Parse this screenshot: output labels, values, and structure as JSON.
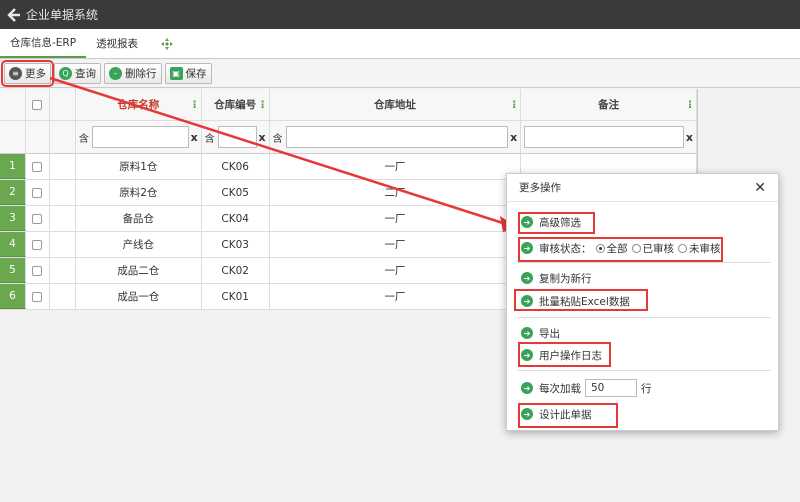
{
  "app": {
    "title": "企业单据系统"
  },
  "tabs": [
    {
      "label": "仓库信息-ERP",
      "active": true
    },
    {
      "label": "透视报表",
      "active": false
    }
  ],
  "toolbar": {
    "more": "更多",
    "query": "查询",
    "delete_row": "删除行",
    "save": "保存"
  },
  "grid": {
    "columns": {
      "name": "仓库名称",
      "code": "仓库编号",
      "address": "仓库地址",
      "note": "备注"
    },
    "filter": {
      "contains": "含",
      "clear": "x"
    },
    "rows": [
      {
        "num": "1",
        "name": "原料1仓",
        "code": "CK06",
        "address": "一厂"
      },
      {
        "num": "2",
        "name": "原料2仓",
        "code": "CK05",
        "address": "二厂"
      },
      {
        "num": "3",
        "name": "备品仓",
        "code": "CK04",
        "address": "一厂"
      },
      {
        "num": "4",
        "name": "产线仓",
        "code": "CK03",
        "address": "一厂"
      },
      {
        "num": "5",
        "name": "成品二仓",
        "code": "CK02",
        "address": "一厂"
      },
      {
        "num": "6",
        "name": "成品一仓",
        "code": "CK01",
        "address": "一厂"
      }
    ]
  },
  "modal": {
    "title": "更多操作",
    "advanced_filter": "高级筛选",
    "review_status_label": "审核状态：",
    "review_options": [
      "全部",
      "已审核",
      "未审核"
    ],
    "review_selected": "全部",
    "copy_new_row": "复制为新行",
    "batch_paste": "批量粘贴Excel数据",
    "export": "导出",
    "user_log": "用户操作日志",
    "load_label": "每次加载",
    "load_value": "50",
    "load_unit": "行",
    "design": "设计此单据"
  },
  "colors": {
    "accent": "#5b9d4a",
    "highlight": "#e53935",
    "header_name": "#c0392b",
    "row_number_bg": "#6aa84f"
  }
}
